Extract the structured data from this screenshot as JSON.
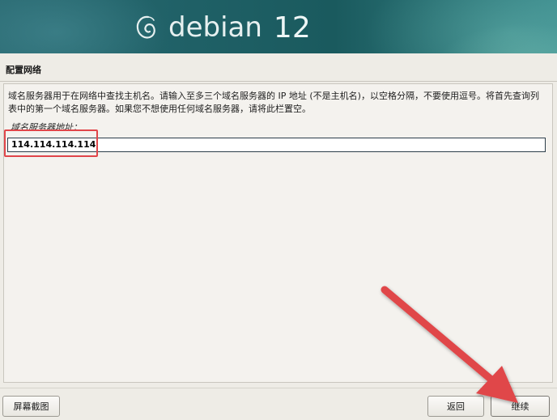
{
  "header": {
    "logo_word": "debian",
    "version": "12"
  },
  "section": {
    "title": "配置网络"
  },
  "content": {
    "description": "域名服务器用于在网络中查找主机名。请输入至多三个域名服务器的 IP 地址 (不是主机名)，以空格分隔，不要使用逗号。将首先查询列表中的第一个域名服务器。如果您不想使用任何域名服务器，请将此栏置空。",
    "field_label": "域名服务器地址：",
    "dns_value": "114.114.114.114"
  },
  "footer": {
    "screenshot_label": "屏幕截图",
    "back_label": "返回",
    "continue_label": "继续"
  },
  "colors": {
    "annotation": "#e0464a",
    "banner_primary": "#1f6066"
  },
  "icons": {
    "logo": "debian-swirl-icon"
  }
}
